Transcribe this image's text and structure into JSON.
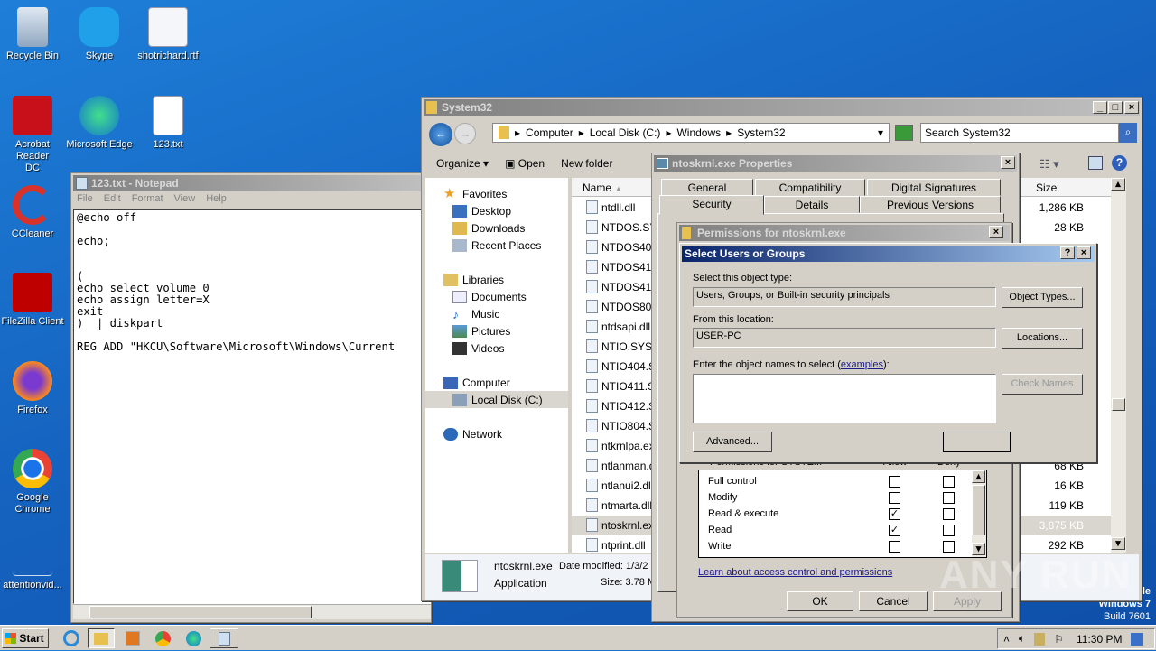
{
  "desktop": {
    "icons": [
      {
        "label": "Recycle Bin",
        "icon": "recycle-bin-icon"
      },
      {
        "label": "Skype",
        "icon": "skype-icon"
      },
      {
        "label": "shotrichard.rtf",
        "icon": "word-document-icon"
      },
      {
        "label": "Acrobat Reader DC",
        "icon": "acrobat-icon"
      },
      {
        "label": "Microsoft Edge",
        "icon": "edge-icon"
      },
      {
        "label": "123.txt",
        "icon": "text-file-icon"
      },
      {
        "label": "CCleaner",
        "icon": "ccleaner-icon"
      },
      {
        "label": "FileZilla Client",
        "icon": "filezilla-icon"
      },
      {
        "label": "Firefox",
        "icon": "firefox-icon"
      },
      {
        "label": "Google Chrome",
        "icon": "chrome-icon"
      },
      {
        "label": "attentionvid...",
        "icon": "file-icon"
      }
    ],
    "os_watermark": {
      "line1": "le",
      "line2": "Windows 7",
      "line3": "Build 7601"
    },
    "anyrun_watermark": "ANY RUN"
  },
  "notepad": {
    "title": "123.txt - Notepad",
    "menu": [
      "File",
      "Edit",
      "Format",
      "View",
      "Help"
    ],
    "content": "@echo off\n\necho;\n\n\n(\necho select volume 0\necho assign letter=X\nexit\n)  | diskpart\n\nREG ADD \"HKCU\\Software\\Microsoft\\Windows\\Current"
  },
  "explorer": {
    "title": "System32",
    "breadcrumb": [
      "Computer",
      "Local Disk (C:)",
      "Windows",
      "System32"
    ],
    "search_placeholder": "Search System32",
    "toolbar": {
      "organize": "Organize",
      "open": "Open",
      "new_folder": "New folder"
    },
    "nav": {
      "favorites": "Favorites",
      "desktop": "Desktop",
      "downloads": "Downloads",
      "recent": "Recent Places",
      "libraries": "Libraries",
      "documents": "Documents",
      "music": "Music",
      "pictures": "Pictures",
      "videos": "Videos",
      "computer": "Computer",
      "local_disk": "Local Disk (C:)",
      "network": "Network"
    },
    "columns": {
      "name": "Name",
      "size": "Size"
    },
    "files": [
      {
        "name": "ntdll.dll",
        "size": "1,286 KB"
      },
      {
        "name": "NTDOS.SYS",
        "size": "28 KB"
      },
      {
        "name": "NTDOS404",
        "size": ""
      },
      {
        "name": "NTDOS411",
        "size": ""
      },
      {
        "name": "NTDOS412",
        "size": ""
      },
      {
        "name": "NTDOS804",
        "size": ""
      },
      {
        "name": "ntdsapi.dll",
        "size": ""
      },
      {
        "name": "NTIO.SYS",
        "size": ""
      },
      {
        "name": "NTIO404.S",
        "size": ""
      },
      {
        "name": "NTIO411.S",
        "size": ""
      },
      {
        "name": "NTIO412.S",
        "size": ""
      },
      {
        "name": "NTIO804.S",
        "size": ""
      },
      {
        "name": "ntkrnlpa.ex",
        "size": ""
      },
      {
        "name": "ntlanman.d",
        "size": "68 KB"
      },
      {
        "name": "ntlanui2.dll",
        "size": "16 KB"
      },
      {
        "name": "ntmarta.dll",
        "size": "119 KB"
      },
      {
        "name": "ntoskrnl.ex",
        "size": "3,875 KB",
        "selected": true
      },
      {
        "name": "ntprint.dll",
        "size": "292 KB"
      }
    ],
    "details": {
      "name": "ntoskrnl.exe",
      "type": "Application",
      "date_label": "Date modified: 1/3/2",
      "size_label": "Size: 3.78 M"
    }
  },
  "properties": {
    "title": "ntoskrnl.exe Properties",
    "tabs_row1": [
      "General",
      "Compatibility",
      "Digital Signatures"
    ],
    "tabs_row2": [
      "Security",
      "Details",
      "Previous Versions"
    ],
    "active_tab": "Security",
    "ok": "OK",
    "cancel": "Cancel",
    "apply": "Apply"
  },
  "permissions": {
    "title": "Permissions for ntoskrnl.exe",
    "group_header": "Permissions for SYSTEM",
    "allow": "Allow",
    "deny": "Deny",
    "rows": [
      {
        "label": "Full control",
        "allow": false,
        "deny": false
      },
      {
        "label": "Modify",
        "allow": false,
        "deny": false
      },
      {
        "label": "Read & execute",
        "allow": true,
        "deny": false
      },
      {
        "label": "Read",
        "allow": true,
        "deny": false
      },
      {
        "label": "Write",
        "allow": false,
        "deny": false
      }
    ],
    "learn_link": "Learn about access control and permissions"
  },
  "select_users": {
    "title": "Select Users or Groups",
    "object_type_label": "Select this object type:",
    "object_type_value": "Users, Groups, or Built-in security principals",
    "object_types_btn": "Object Types...",
    "location_label": "From this location:",
    "location_value": "USER-PC",
    "locations_btn": "Locations...",
    "names_label_pre": "Enter the object names to select (",
    "names_link": "examples",
    "names_label_post": "):",
    "names_value": "",
    "check_names_btn": "Check Names",
    "advanced_btn": "Advanced...",
    "ok_btn": ""
  },
  "taskbar": {
    "start": "Start",
    "time": "11:30 PM",
    "apps": [
      "ie-icon",
      "explorer-icon",
      "media-player-icon",
      "chrome-icon",
      "edge-icon",
      "notepad-icon"
    ]
  }
}
